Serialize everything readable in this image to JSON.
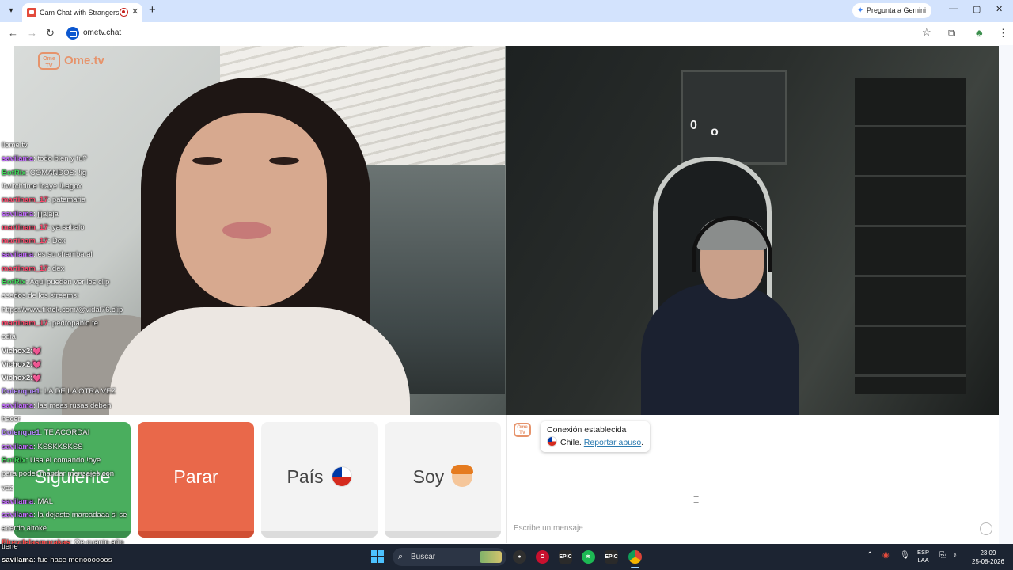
{
  "browser": {
    "tab_title": "Cam Chat with Strangers on",
    "tab_close": "✕",
    "new_tab": "+",
    "gemini_label": "Pregunta a Gemini",
    "url": "ometv.chat",
    "window_controls": [
      "—",
      "▢",
      "✕"
    ]
  },
  "logo": {
    "mark": "Ome TV",
    "text": "Ome.tv"
  },
  "stream_chat": [
    {
      "user": "",
      "text": "llome.tv",
      "color": "#f4f4f4"
    },
    {
      "user": "savilama",
      "text": "todo bien y tu?",
      "color": "#c46bff"
    },
    {
      "user": "BotRix",
      "text": "COMANDOS: !ig",
      "color": "#42d95c"
    },
    {
      "user": "",
      "text": "!twitchtime !caye !Lagox",
      "color": "#f4f4f4"
    },
    {
      "user": "martinam_17",
      "text": "patamaria",
      "color": "#ff4a6e"
    },
    {
      "user": "savilama",
      "text": "jjjajaja",
      "color": "#c46bff"
    },
    {
      "user": "martinam_17",
      "text": "ya sabalo",
      "color": "#ff4a6e"
    },
    {
      "user": "martinam_17",
      "text": "Dex",
      "color": "#ff4a6e"
    },
    {
      "user": "savilama",
      "text": "es su chamba al",
      "color": "#c46bff"
    },
    {
      "user": "martinam_17",
      "text": "dex",
      "color": "#ff4a6e"
    },
    {
      "user": "BotRix",
      "text": "Aqui pueden ver los clip",
      "color": "#42d95c"
    },
    {
      "user": "",
      "text": "asados de los streams:",
      "color": "#f4f4f4"
    },
    {
      "user": "",
      "text": "https://www.tiktok.com/@vidal76.clip",
      "color": "#f4f4f4"
    },
    {
      "user": "martinam_17",
      "text": "pedropablo te",
      "color": "#ff4a6e"
    },
    {
      "user": "",
      "text": "odia",
      "color": "#f4f4f4"
    },
    {
      "user": "Vichox2",
      "text": ":💓",
      "color": "#f4f4f4"
    },
    {
      "user": "Vichox2",
      "text": ":💓",
      "color": "#f4f4f4"
    },
    {
      "user": "Vichox2",
      "text": ":💓",
      "color": "#f4f4f4"
    },
    {
      "user": "Dolenque1",
      "text": ": LA DE LA OTRA VEZ",
      "color": "#b78bff"
    },
    {
      "user": "savilama",
      "text": "las meas rusas deben",
      "color": "#c46bff"
    },
    {
      "user": "",
      "text": "hacer",
      "color": "#f4f4f4"
    },
    {
      "user": "Dolenque1",
      "text": ": TE ACORDAI",
      "color": "#b78bff"
    },
    {
      "user": "savilama",
      "text": "KSSKKSKSS",
      "color": "#c46bff"
    },
    {
      "user": "BotRix",
      "text": "Usa el comando !oye",
      "color": "#42d95c"
    },
    {
      "user": "",
      "text": "para poder mandar mensajes con",
      "color": "#f4f4f4"
    },
    {
      "user": "",
      "text": "voz",
      "color": "#f4f4f4"
    },
    {
      "user": "savilama",
      "text": "MAL",
      "color": "#c46bff"
    },
    {
      "user": "savilama",
      "text": "la dejaste marcadaaa si se",
      "color": "#c46bff"
    },
    {
      "user": "",
      "text": "acerdo altoke",
      "color": "#f4f4f4"
    },
    {
      "user": "Elreydelasmorakas",
      "text": "Oe cuanto año",
      "color": "#ff4a4a"
    }
  ],
  "overlay_tail": [
    {
      "user": "",
      "text": "tiene"
    },
    {
      "user": "savilama",
      "text": "fue hace menoooooos"
    }
  ],
  "buttons": {
    "next": "Siguiente",
    "stop": "Parar",
    "country": "País",
    "gender": "Soy"
  },
  "chat": {
    "status": "Conexión establecida",
    "country": "Chile.",
    "report": "Reportar abuso",
    "report_suffix": ".",
    "placeholder": "Escribe un mensaje"
  },
  "video_overlay": {
    "left_text": "0",
    "right_text": "o"
  },
  "taskbar": {
    "search_placeholder": "Buscar",
    "lang_line1": "ESP",
    "lang_line2": "LAA",
    "time": "23:09",
    "date": "25-08-2026",
    "app_labels": [
      "EPIC",
      "EPIC"
    ]
  },
  "colors": {
    "next": "#4aae5e",
    "stop": "#e9684a",
    "brand": "#e6936b"
  }
}
